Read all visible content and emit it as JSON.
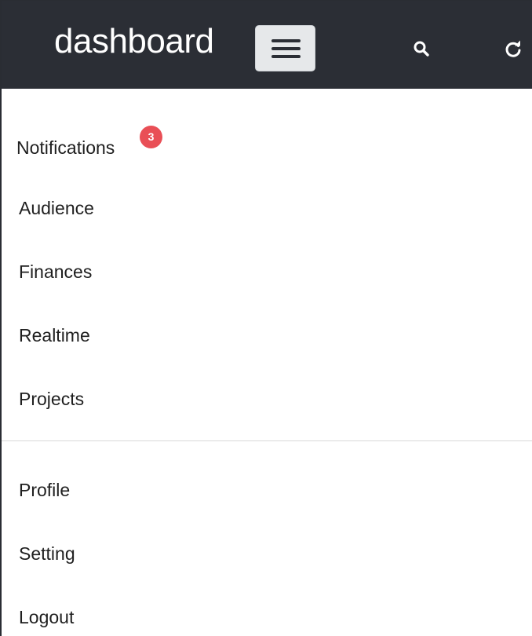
{
  "header": {
    "brand": "dashboard",
    "menu_button_icon": "hamburger-menu-icon",
    "search_icon": "search-icon",
    "refresh_icon": "refresh-icon",
    "background_color": "#2b2e35"
  },
  "nav": {
    "primary": [
      {
        "label": "Notifications",
        "badge": "3"
      },
      {
        "label": "Audience"
      },
      {
        "label": "Finances"
      },
      {
        "label": "Realtime"
      },
      {
        "label": "Projects"
      }
    ],
    "secondary": [
      {
        "label": "Profile"
      },
      {
        "label": "Setting"
      },
      {
        "label": "Logout"
      }
    ]
  },
  "colors": {
    "badge": "#e94f56",
    "text": "#1f1f1f"
  }
}
